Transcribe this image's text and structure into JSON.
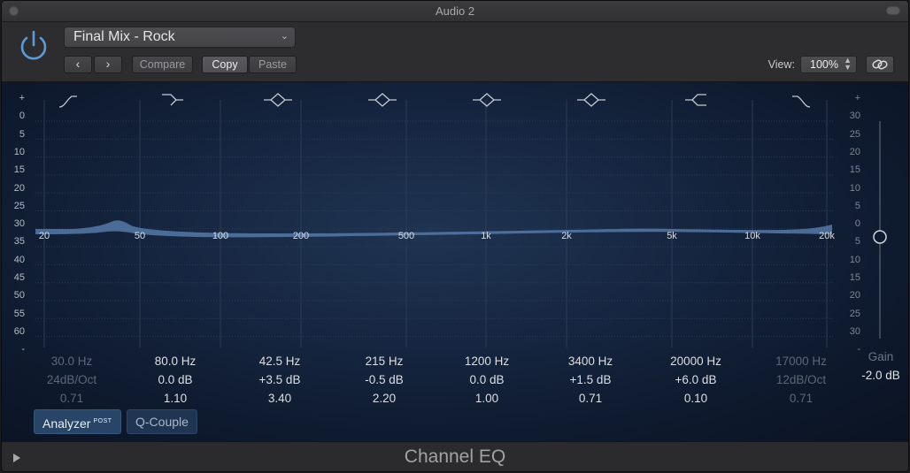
{
  "window": {
    "title": "Audio 2"
  },
  "header": {
    "preset": "Final Mix - Rock",
    "prev_icon": "chevron-left-icon",
    "next_icon": "chevron-right-icon",
    "compare_label": "Compare",
    "copy_label": "Copy",
    "paste_label": "Paste",
    "view_label": "View:",
    "view_value": "100%",
    "link_icon": "link-icon"
  },
  "eq": {
    "db_left": [
      "+",
      "0",
      "5",
      "10",
      "15",
      "20",
      "25",
      "30",
      "35",
      "40",
      "45",
      "50",
      "55",
      "60",
      "-"
    ],
    "db_right": [
      "+",
      "30",
      "25",
      "20",
      "15",
      "10",
      "5",
      "0",
      "5",
      "10",
      "15",
      "20",
      "25",
      "30",
      "-"
    ],
    "freq_labels": [
      "20",
      "50",
      "100",
      "200",
      "500",
      "1k",
      "2k",
      "5k",
      "10k",
      "20k"
    ],
    "bands": [
      {
        "icon": "low-cut-icon",
        "freq": "30.0 Hz",
        "gain": "24dB/Oct",
        "q": "0.71",
        "enabled": false
      },
      {
        "icon": "low-shelf-icon",
        "freq": "80.0 Hz",
        "gain": "0.0 dB",
        "q": "1.10",
        "enabled": true
      },
      {
        "icon": "bell-icon",
        "freq": "42.5 Hz",
        "gain": "+3.5 dB",
        "q": "3.40",
        "enabled": true
      },
      {
        "icon": "bell-icon",
        "freq": "215 Hz",
        "gain": "-0.5 dB",
        "q": "2.20",
        "enabled": true
      },
      {
        "icon": "bell-icon",
        "freq": "1200 Hz",
        "gain": "0.0 dB",
        "q": "1.00",
        "enabled": true
      },
      {
        "icon": "bell-icon",
        "freq": "3400 Hz",
        "gain": "+1.5 dB",
        "q": "0.71",
        "enabled": true
      },
      {
        "icon": "high-shelf-icon",
        "freq": "20000 Hz",
        "gain": "+6.0 dB",
        "q": "0.10",
        "enabled": true
      },
      {
        "icon": "high-cut-icon",
        "freq": "17000 Hz",
        "gain": "12dB/Oct",
        "q": "0.71",
        "enabled": false
      }
    ],
    "gain_label": "Gain",
    "gain_value": "-2.0 dB",
    "analyzer_label": "Analyzer",
    "analyzer_tag": "POST",
    "qcouple_label": "Q-Couple",
    "accent": "#7da3d6"
  },
  "footer": {
    "plugin_name": "Channel EQ"
  }
}
